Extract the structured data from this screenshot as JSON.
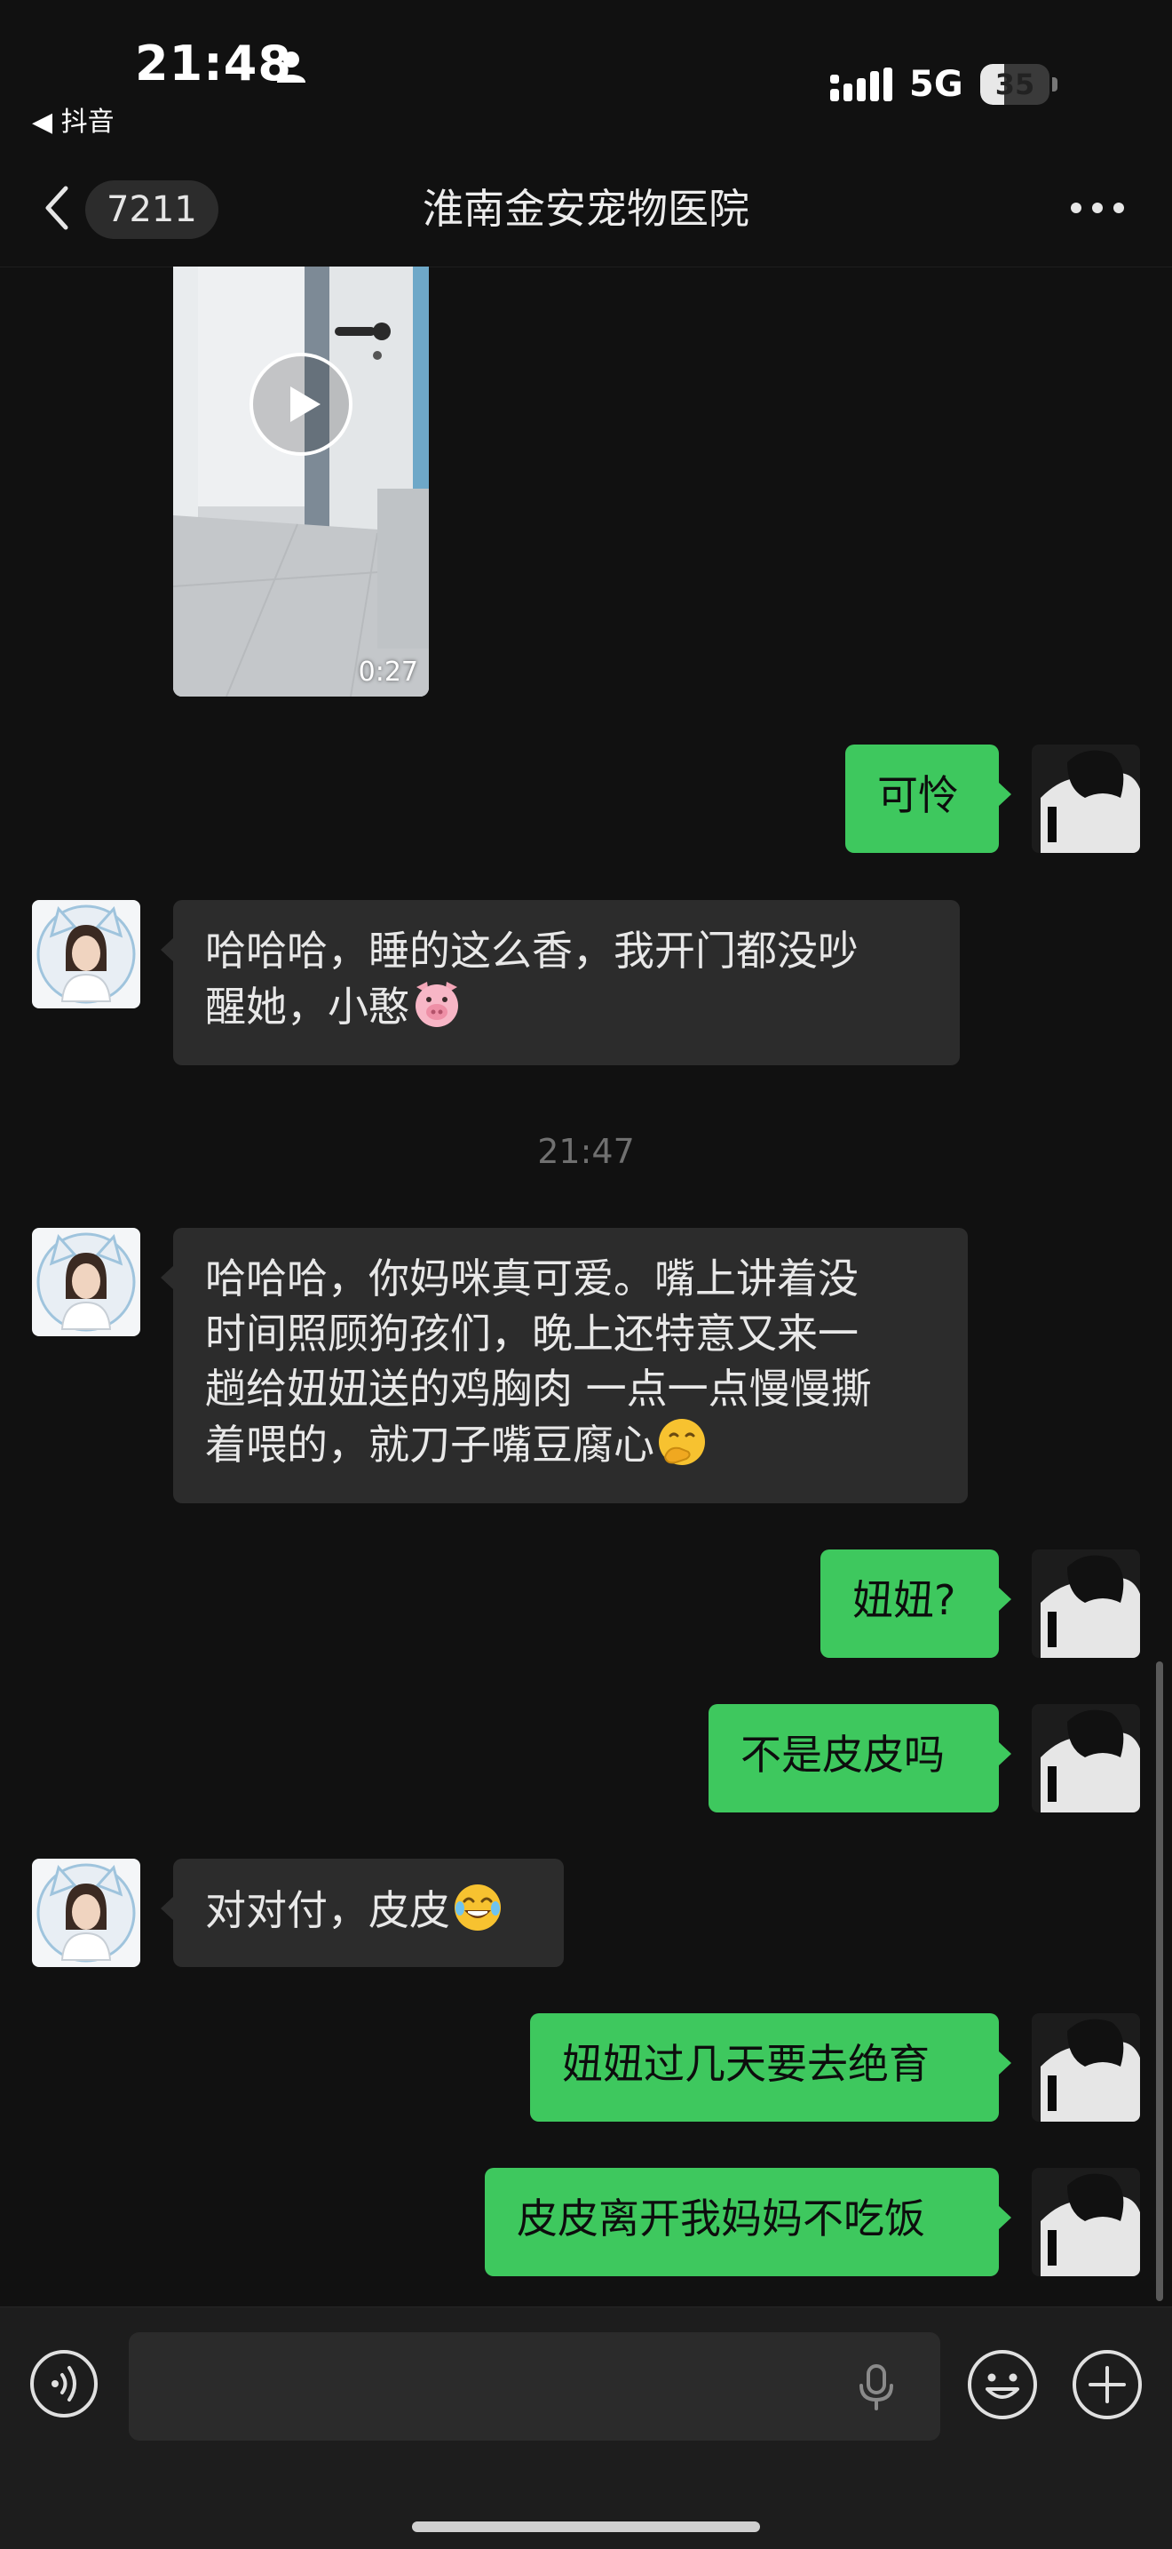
{
  "status_bar": {
    "time": "21:48",
    "back_app": "◀ 抖音",
    "network": "5G",
    "battery_level": "35",
    "battery_fraction": 0.35
  },
  "nav": {
    "unread_count": "7211",
    "title": "淮南金安宠物医院"
  },
  "video_message": {
    "duration": "0:27"
  },
  "messages": [
    {
      "side": "out",
      "text": "可怜"
    },
    {
      "side": "in",
      "text_lines": [
        "哈哈哈，睡的这么香，我开门都没吵",
        "醒她，小憨"
      ],
      "emoji": "pig-face-emoji"
    },
    {
      "side": "in",
      "text_lines": [
        "哈哈哈，你妈咪真可爱。嘴上讲着没",
        "时间照顾狗孩们，晚上还特意又来一",
        "趟给妞妞送的鸡胸肉 一点一点慢慢撕",
        "着喂的，就刀子嘴豆腐心"
      ],
      "emoji": "thinking-hand-over-mouth-emoji"
    },
    {
      "side": "out",
      "text": "妞妞?"
    },
    {
      "side": "out",
      "text": "不是皮皮吗"
    },
    {
      "side": "in",
      "text": "对对付，皮皮",
      "emoji": "tears-of-joy-emoji"
    },
    {
      "side": "out",
      "text": "妞妞过几天要去绝育"
    },
    {
      "side": "out",
      "text": "皮皮离开我妈妈不吃饭"
    }
  ],
  "timestamp": "21:47",
  "colors": {
    "background": "#111111",
    "incoming_bubble": "#2c2c2c",
    "outgoing_bubble": "#3ec85e",
    "input_bar": "#1d1d1d"
  }
}
